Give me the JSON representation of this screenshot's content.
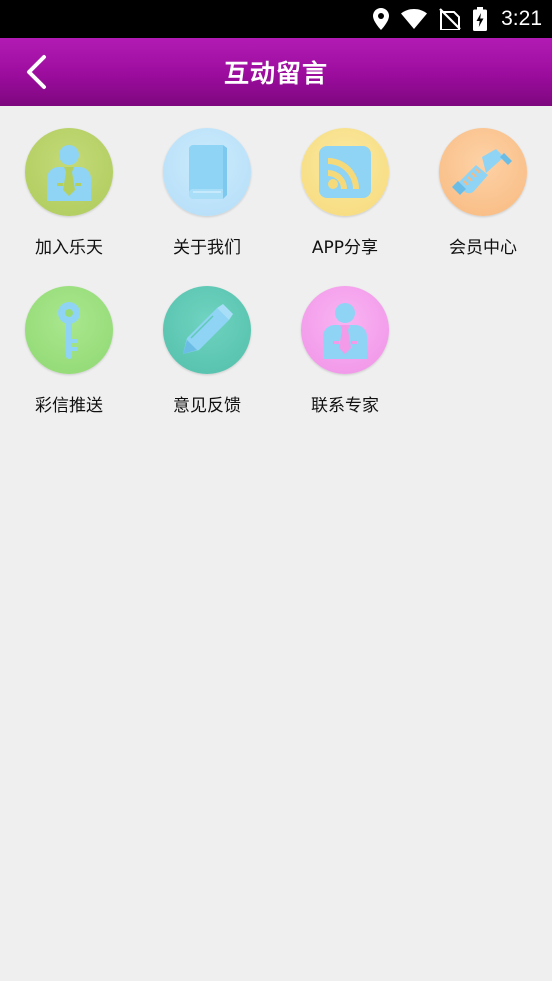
{
  "status_bar": {
    "time": "3:21",
    "icons": [
      "location-icon",
      "wifi-icon",
      "no-signal-icon",
      "battery-charging-icon"
    ]
  },
  "header": {
    "title": "互动留言",
    "back_icon": "chevron-left-icon",
    "background": "#9b0c9d"
  },
  "menu": {
    "items": [
      {
        "label": "加入乐天",
        "icon": "person-tie-icon",
        "color": "#b9d36a"
      },
      {
        "label": "关于我们",
        "icon": "book-icon",
        "color": "#bfe6fb"
      },
      {
        "label": "APP分享",
        "icon": "rss-icon",
        "color": "#f9e28c"
      },
      {
        "label": "会员中心",
        "icon": "handshake-icon",
        "color": "#fbc48d"
      },
      {
        "label": "彩信推送",
        "icon": "key-icon",
        "color": "#9be07e"
      },
      {
        "label": "意见反馈",
        "icon": "pencil-icon",
        "color": "#5fcab6"
      },
      {
        "label": "联系专家",
        "icon": "person-tie-icon",
        "color": "#f6a1ee"
      }
    ]
  }
}
